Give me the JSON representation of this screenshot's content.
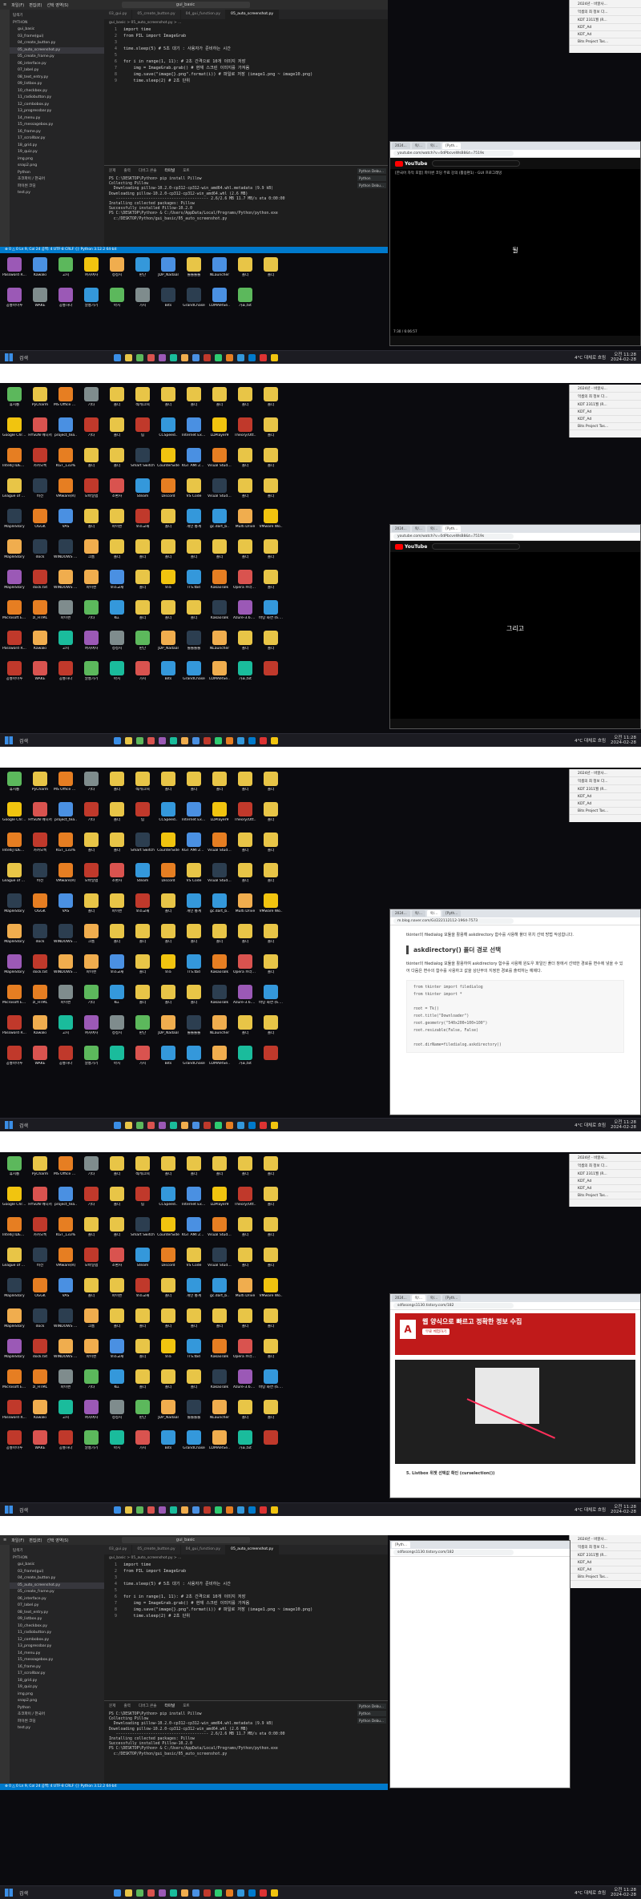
{
  "desktop": {
    "icons_full": [
      "휴지통",
      "PyCharm",
      "MS Office 2021 Pr..",
      "기타",
      "폴더",
      "책/워크북",
      "폴더",
      "폴더",
      "폴더",
      "폴더",
      "폴더",
      "Google Chrome",
      "HYSUN 메니저",
      "project_tea..",
      "기타",
      "폴더",
      "팁",
      "CCSpeed..",
      "Internet Explorer",
      "LDPlayer9",
      "Theory/Ott..",
      "폴더",
      "IntelliJ IDEA Commun..",
      "카카오톡",
      "KGT_133%",
      "폴더",
      "폴더",
      "Smart Switch",
      "CounterSide",
      "KGT AMI 2021.10.04",
      "Visual Studio 2022",
      "폴더",
      "폴더",
      "League of Legends",
      "비전",
      "VMware(R)",
      "모바일맵",
      "소환사",
      "Steam",
      "Discord",
      "VS Code",
      "Visual Studio Code",
      "폴더",
      "폴더",
      "MapleStory",
      "OGGK",
      "VAS",
      "폴더",
      "파이썬",
      "보조교재",
      "폴더",
      "개인 통계",
      "gc.dart_b..",
      "Multi Drive",
      "VMware Wo..",
      "MapleStory",
      "dock",
      "WINDOWS 8A",
      "크롬",
      "폴더",
      "폴더",
      "폴더",
      "폴더",
      "폴더",
      "폴더",
      "폴더",
      "MapleStory",
      "dock.txt",
      "WINDOWS 8A",
      "파이썬",
      "보조교재",
      "폴더",
      "보조",
      "ITS.tbd",
      "KakaoTalk",
      "Opera 브라우저",
      "폴더",
      "Microsoft Edge",
      "zl_HTML",
      "파이썬",
      "기타",
      "Ku.",
      "폴더",
      "폴더",
      "폴더",
      "KakaoTalk",
      "Azure-3.6.exe",
      "바탕 화면 (6.6.0)",
      "Password Recovery",
      "Kawaki",
      "고시",
      "여자여자",
      "정정치",
      "판단",
      "JDP_Nadaal",
      "롤롤롤롤",
      "NLauncher",
      "폴더",
      "폴더",
      "공룡마이투",
      "WAKE",
      "공룡하나",
      "알롱가기",
      "아치",
      "가지",
      "Bits",
      "GrandChase",
      "LOMAIRSe..",
      "가효,txt",
      ""
    ],
    "icons_recent": [
      "Password Recovery",
      "Kawaki",
      "고시",
      "여자여자",
      "정정치",
      "판단",
      "JDP_Nadaal",
      "롤롤롤롤",
      "NLauncher",
      "폴더",
      "폴더",
      "공룡마이투",
      "WAKE",
      "공룡하나",
      "알롱가기",
      "아치",
      "가지",
      "Bits",
      "GrandChase",
      "LOMAIRSe..",
      "가효,txt"
    ],
    "top_right_icons": [
      "새 폴더",
      "GRAMDOC...",
      "",
      "폴더"
    ],
    "side_icons": [
      "휴지통",
      "사용자",
      "",
      "",
      "내 PC"
    ]
  },
  "window_list": [
    "2024년 - 바꿀사...",
    "먹셈의 최 정보 다...",
    "KDT 2311월 (R...",
    "KDT_Ad",
    "KDT_Ad",
    "Bits Project Tas..."
  ],
  "taskbar": {
    "search_label": "검색",
    "weather": "4°C 대체로 흐림",
    "time": "오전 11:28",
    "date": "2024-02-28"
  },
  "vscode": {
    "title": "gui_basic",
    "tabs": [
      "03_gui.py",
      "05_create_button.py",
      "04_gui_function.py",
      "05_auto_screenshot.py"
    ],
    "breadcrumb": "gui_basic > 05_auto_screenshot.py > ...",
    "explorer_title": "탐색기",
    "explorer_section": "PYTHON",
    "files": [
      "gui_basic",
      "03_frame(gui)",
      "04_create_button.py",
      "05_auto_screenshot.py",
      "05_create_frame.py",
      "06_interface.py",
      "07_label.py",
      "08_text_entry.py",
      "09_listbox.py",
      "10_checkbox.py",
      "11_radiobutton.py",
      "12_combobox.py",
      "13_progressbar.py",
      "14_menu.py",
      "15_messagebox.py",
      "16_frame.py",
      "17_scrollbar.py",
      "18_grid.py",
      "19_quiz.py",
      "img.png",
      "snap2.png",
      "Python",
      "초코파이 / 한국어",
      "파이썬 코딩",
      "test.py"
    ],
    "code": [
      {
        "n": "1",
        "t": "import time"
      },
      {
        "n": "2",
        "t": "from PIL import ImageGrab"
      },
      {
        "n": "3",
        "t": ""
      },
      {
        "n": "4",
        "t": "time.sleep(5) # 5초 대기 : 사용자가 준비하는 시간"
      },
      {
        "n": "5",
        "t": ""
      },
      {
        "n": "6",
        "t": "for i in range(1, 11): # 2초 간격으로 10개 이미지 저장"
      },
      {
        "n": "7",
        "t": "    img = ImageGrab.grab() # 현재 스크린 이미지를 가져옴"
      },
      {
        "n": "8",
        "t": "    img.save(\"image{}.png\".format(i)) # 파일로 저장 (image1.png ~ image10.png)"
      },
      {
        "n": "9",
        "t": "    time.sleep(2) # 2초 단위"
      }
    ],
    "panel_tabs": [
      "문제",
      "출력",
      "디버그 콘솔",
      "터미널",
      "포트"
    ],
    "terminal": [
      "PS C:\\DESKTOP\\Python> pip install Pillow",
      "Collecting Pillow",
      "  Downloading pillow-10.2.0-cp312-cp312-win_amd64.whl.metadata (9.9 kB)",
      "Downloading pillow-10.2.0-cp312-cp312-win_amd64.whl (2.6 MB)",
      "   ---------------------------------------- 2.6/2.6 MB 11.7 MB/s eta 0:00:00",
      "Installing collected packages: Pillow",
      "Successfully installed Pillow-10.2.0",
      "PS C:\\DESKTOP\\Python> & C:/Users/AppData/Local/Programs/Python/python.exe",
      "  c:/DESKTOP/Python/gui_basic/05_auto_screenshot.py",
      ""
    ],
    "terminal_list": [
      "Python Debu...",
      "Python",
      "Python Debu..."
    ],
    "status": "⊗ 0 △ 0   Ln 9, Col 24   공백: 4   UTF-8   CRLF   {} Python   3.12.2 64-bit"
  },
  "youtube": {
    "tabs": [
      "2024...",
      "목/...",
      "목/...",
      "[Pyth..."
    ],
    "url": "youtube.com/watch?v=0dPbcveWsB8&t=7519s",
    "logo_text": "YouTube",
    "description": "[한국어 자막 포함] 파이썬 코딩 무료 강의 (활용편1) - GUI 프로그래밍",
    "subtitle_1": "될",
    "subtitle_2": "그리고",
    "time_1": "7:30 / 6:06:57"
  },
  "blog": {
    "url": "m.blog.naver.com/Gi/222112112-1964-7573",
    "para1": "tkinter의 filedialog 모듈을 활용해 askdirectory 함수를 사용해 폴더 위치 선택 방법 작성합니다.",
    "heading": "askdirectory() 폴더 경로 선택",
    "para2": "tkinter의 filedialog 모듈을 활용하여 askdirectory 함수를 사용해 원도우 파일인 폴더 창에서 선택한 경로를 변수에 넣을 수 있어 다음은 변수의 함수를 사용하고 값을 상단부의 지정한 경로를 출력하는 예제다.",
    "code": "from tkinter import filedialog\nfrom tkinter import *\n\nroot = Tk()\nroot.title(\"Downloader\")\nroot.geometry(\"540x200+100+100\")\nroot.resizable(False, False)\n\nroot.dirName=filedialog.askdirectory()"
  },
  "tistory": {
    "url": "sdfasongs1130.tistory.com/182",
    "ad_title": "웹 양식으로 빠르고 정확한 정보 수집",
    "ad_button": "무료 체험하기",
    "ad_logo": "A",
    "caption": "5. Listbox 위젯 선택값 확인 (curselection())"
  }
}
